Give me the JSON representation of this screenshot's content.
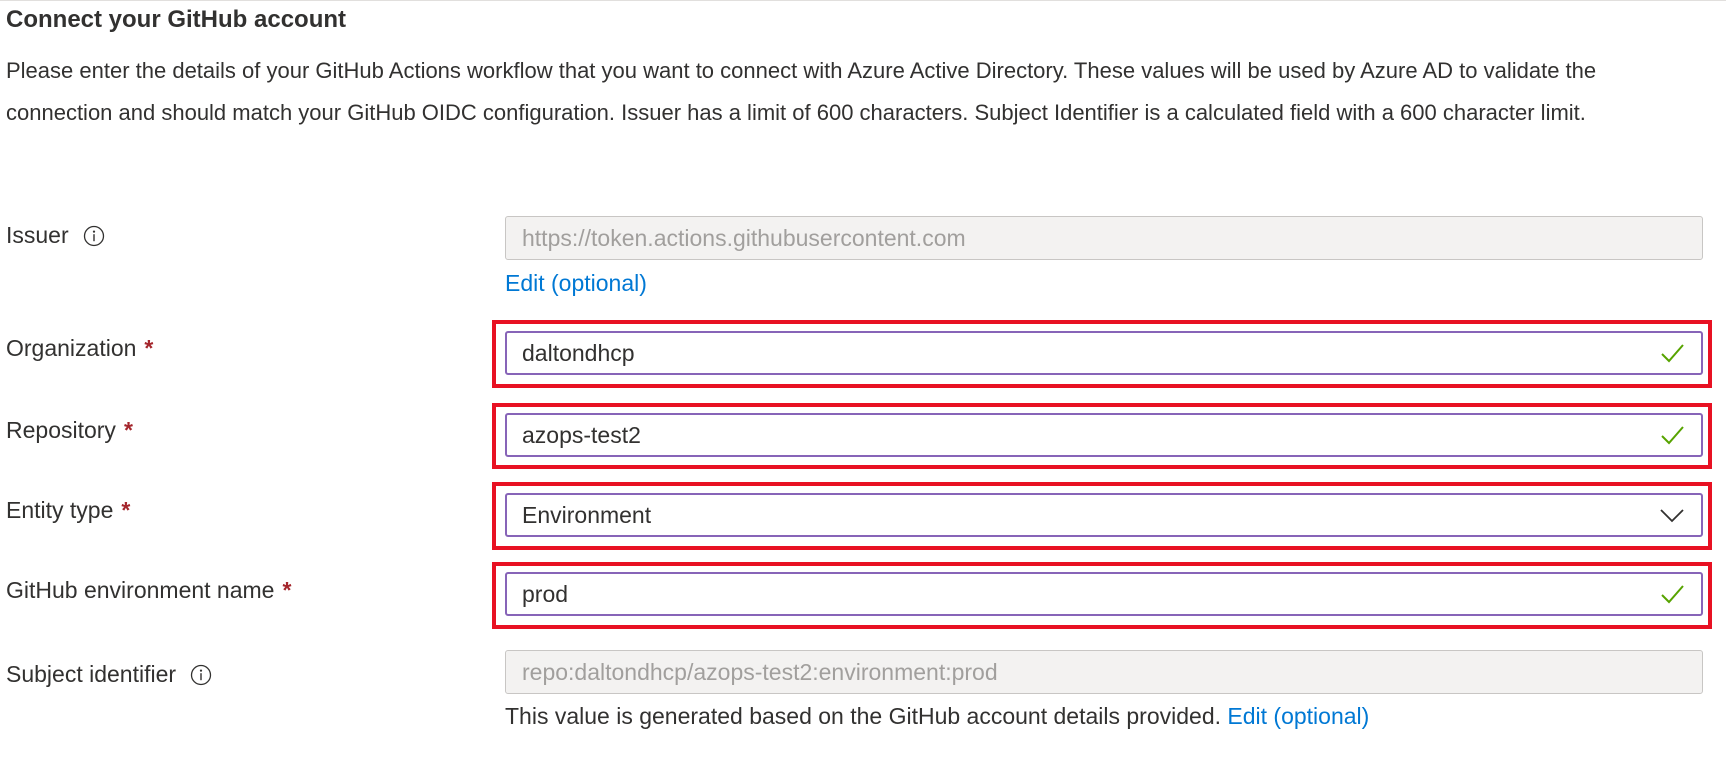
{
  "title": "Connect your GitHub account",
  "description": "Please enter the details of your GitHub Actions workflow that you want to connect with Azure Active Directory. These values will be used by Azure AD to validate the connection and should match your GitHub OIDC configuration. Issuer has a limit of 600 characters. Subject Identifier is a calculated field with a 600 character limit.",
  "required_marker": "*",
  "fields": {
    "issuer": {
      "label": "Issuer",
      "value": "https://token.actions.githubusercontent.com",
      "edit_link": "Edit (optional)",
      "disabled": true
    },
    "organization": {
      "label": "Organization",
      "value": "daltondhcp",
      "valid": true
    },
    "repository": {
      "label": "Repository",
      "value": "azops-test2",
      "valid": true
    },
    "entity_type": {
      "label": "Entity type",
      "value": "Environment",
      "control": "dropdown"
    },
    "environment_name": {
      "label": "GitHub environment name",
      "value": "prod",
      "valid": true
    },
    "subject_identifier": {
      "label": "Subject identifier",
      "value": "repo:daltondhcp/azops-test2:environment:prod",
      "help_text": "This value is generated based on the GitHub account details provided.",
      "edit_link": "Edit (optional)",
      "disabled": true
    }
  },
  "colors": {
    "highlight": "#e81123",
    "link": "#0078d4",
    "valid_check": "#57a300",
    "required": "#a4262c",
    "focus_border": "#8764b8"
  },
  "icons": [
    "info-icon",
    "checkmark-icon",
    "chevron-down-icon"
  ]
}
